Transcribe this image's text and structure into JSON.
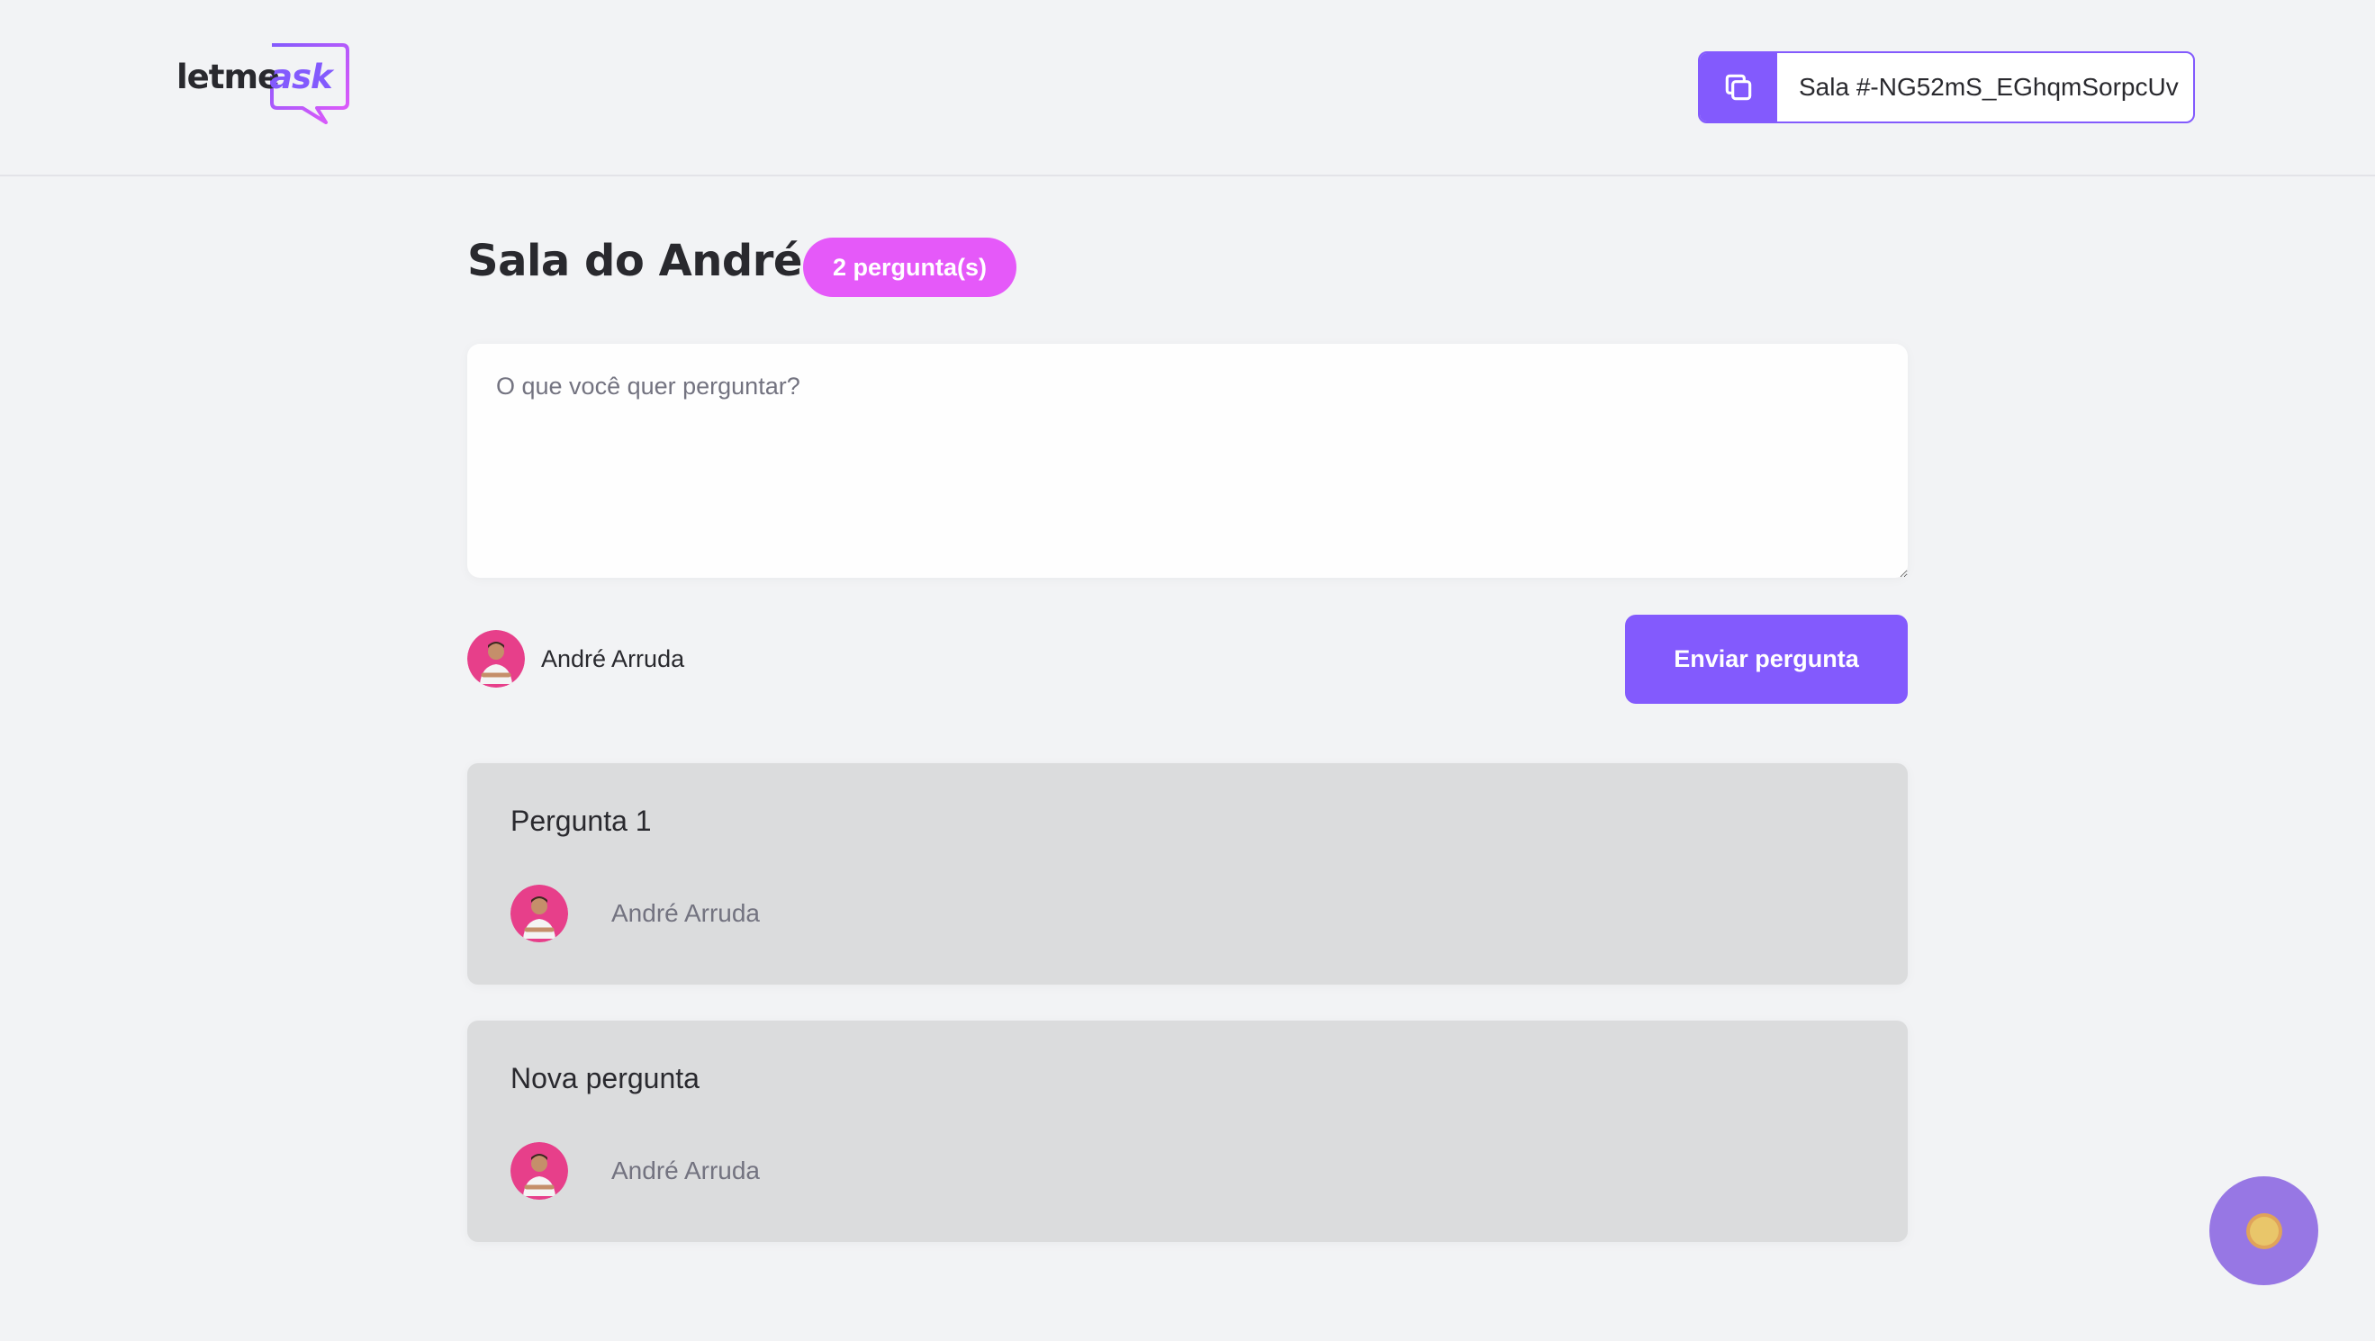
{
  "header": {
    "logo": {
      "part1": "letme",
      "part2": "ask"
    },
    "room_code": {
      "label": "Sala #-NG52mS_EGhqmSorpcUv",
      "icon": "copy-icon"
    }
  },
  "room": {
    "title": "Sala do André",
    "question_count": "2 pergunta(s)"
  },
  "form": {
    "placeholder": "O que você quer perguntar?",
    "value": "",
    "user_name": "André Arruda",
    "submit_label": "Enviar pergunta"
  },
  "questions": [
    {
      "content": "Pergunta 1",
      "author": "André Arruda"
    },
    {
      "content": "Nova pergunta",
      "author": "André Arruda"
    }
  ],
  "colors": {
    "accent": "#835afd",
    "badge": "#e559f9",
    "background": "#f2f3f5",
    "card": "#dbdcdd",
    "theme_toggle": "#9777e4"
  },
  "theme_toggle": {
    "icon": "sun-icon"
  }
}
